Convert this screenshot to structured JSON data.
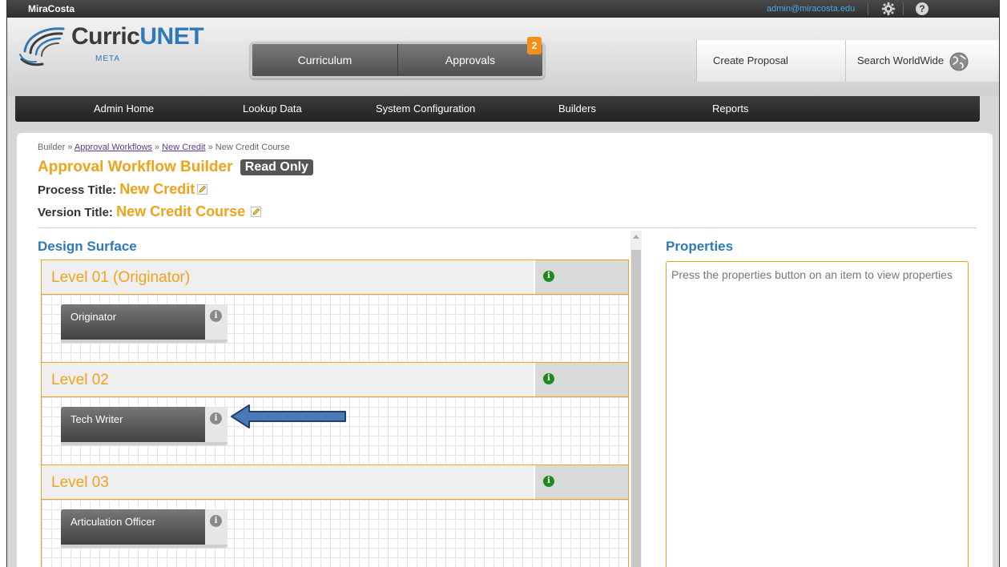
{
  "topbar": {
    "org": "MiraCosta",
    "user_email": "admin@miracosta.edu",
    "help_glyph": "?"
  },
  "logo": {
    "brand_a": "Curric",
    "brand_b": "UNET",
    "tagline": "META"
  },
  "main_nav": {
    "tabs": [
      {
        "label": "Curriculum"
      },
      {
        "label": "Approvals"
      }
    ],
    "approvals_badge": "2"
  },
  "header_buttons": {
    "create_proposal": "Create Proposal",
    "search_worldwide": "Search WorldWide"
  },
  "admin_nav": {
    "items": [
      {
        "label": "Admin Home"
      },
      {
        "label": "Lookup Data"
      },
      {
        "label": "System Configuration"
      },
      {
        "label": "Builders"
      },
      {
        "label": "Reports"
      }
    ]
  },
  "breadcrumb": {
    "root": "Builder",
    "sep": "»",
    "link1": "Approval Workflows",
    "link2": "New Credit",
    "current": "New Credit Course"
  },
  "page": {
    "title": "Approval Workflow Builder",
    "mode_badge": "Read Only",
    "process_label": "Process Title:",
    "process_value": "New Credit",
    "version_label": "Version Title:",
    "version_value": "New Credit Course"
  },
  "design_surface": {
    "title": "Design Surface",
    "info_glyph": "i",
    "levels": [
      {
        "name": "Level 01 (Originator)",
        "step": "Originator"
      },
      {
        "name": "Level 02",
        "step": "Tech Writer"
      },
      {
        "name": "Level 03",
        "step": "Articulation Officer"
      }
    ]
  },
  "properties": {
    "title": "Properties",
    "hint": "Press the properties button on an item to view properties"
  },
  "colors": {
    "accent_orange": "#f0a21a",
    "link_blue": "#2f79b8",
    "info_green": "#1f8a1f",
    "annotation_arrow": "#4a7ab8"
  },
  "icons": [
    "gear-icon",
    "help-icon",
    "globe-icon",
    "edit-pencil-icon",
    "info-icon",
    "annotation-arrow"
  ]
}
